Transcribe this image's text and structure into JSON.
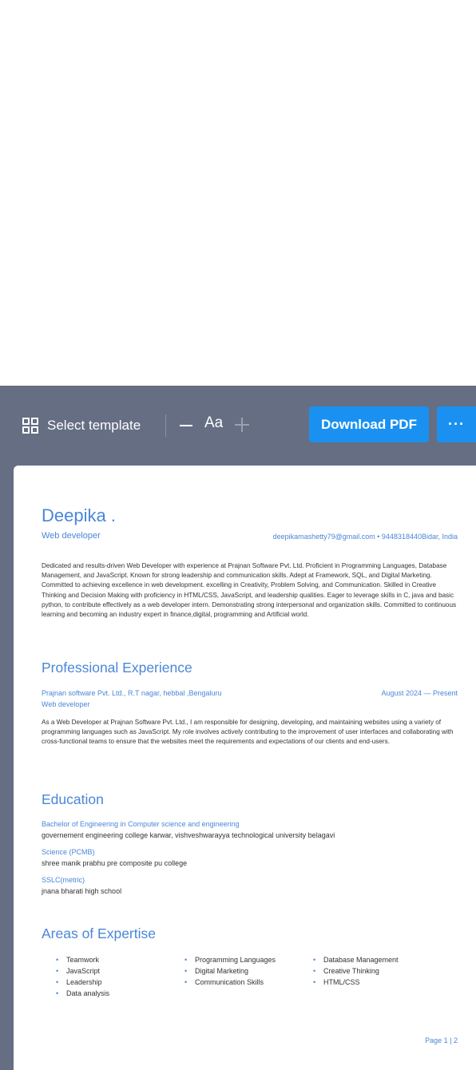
{
  "toolbar": {
    "select_template_label": "Select template",
    "font_size_label": "Aa",
    "download_label": "Download PDF",
    "more_label": "···"
  },
  "resume": {
    "name": "Deepika .",
    "role": "Web developer",
    "contact": "deepikamashetty79@gmail.com • 9448318440Bidar, India",
    "summary": "Dedicated and results-driven Web Developer with experience at Prajnan Software Pvt. Ltd. Proficient in Programming Languages, Database Management, and JavaScript. Known for strong leadership and communication skills. Adept at Framework, SQL, and Digital Marketing. Committed to achieving excellence in web development.  excelling in Creativity, Problem Solving, and Communication. Skilled in Creative Thinking and Decision Making  with proficiency in HTML/CSS, JavaScript, and leadership qualities. Eager to leverage skills in C, java and basic python, to contribute effectively as a web developer intern.  Demonstrating strong interpersonal and organization skills.   Committed to continuous learning and becoming an industry expert in finance,digital, programming and Artificial world.",
    "experience_heading": "Professional Experience",
    "experience": {
      "company": "Prajnan software Pvt. Ltd., R.T nagar, hebbal ,Bengaluru",
      "dates": "August 2024 — Present",
      "title": "Web developer",
      "description": "As a Web Developer at Prajnan Software Pvt. Ltd., I am responsible for designing, developing, and maintaining websites using a variety of programming languages such as JavaScript. My role involves actively contributing to the improvement of user interfaces and collaborating with cross-functional teams to ensure that the websites meet the requirements and expectations of our clients and end-users."
    },
    "education_heading": "Education",
    "education": [
      {
        "degree": "Bachelor of Engineering in Computer science and engineering",
        "school": "governement engineering college karwar, vishveshwarayya technological university belagavi"
      },
      {
        "degree": "Science (PCMB)",
        "school": "shree manik prabhu pre composite pu college"
      },
      {
        "degree": "SSLC(metric)",
        "school": "jnana bharati high school"
      }
    ],
    "expertise_heading": "Areas of Expertise",
    "skills_col1": [
      "Teamwork",
      "JavaScript",
      "Leadership",
      "Data analysis"
    ],
    "skills_col2": [
      "Programming Languages",
      "Digital Marketing",
      "Communication Skills"
    ],
    "skills_col3": [
      "Database Management",
      "Creative Thinking",
      "HTML/CSS"
    ],
    "page_label": "Page 1 | 2"
  }
}
